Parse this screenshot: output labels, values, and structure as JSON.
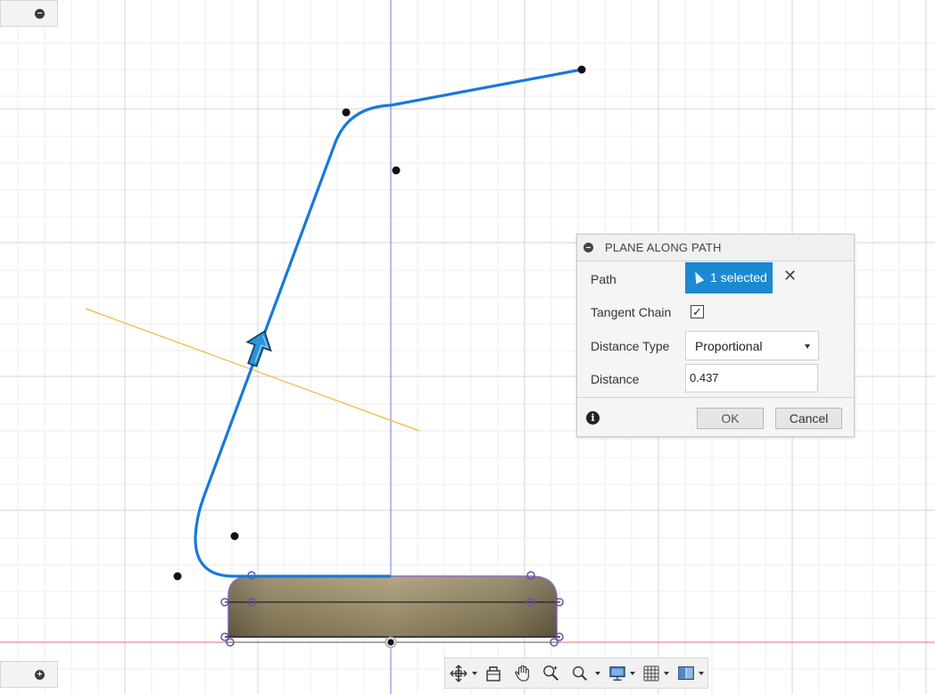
{
  "viewport": {
    "grid_color": "#d9d9d9",
    "path_color": "#1a7de0",
    "plane_color": "#f5b942",
    "body_color": "#8b7d5a",
    "axis_red": "#e05050",
    "axis_blue": "#5a6fd8"
  },
  "browser_toggle_top": {
    "icon": "minus-circle-icon"
  },
  "browser_toggle_bottom": {
    "icon": "plus-circle-icon"
  },
  "dialog": {
    "title": "PLANE ALONG PATH",
    "path_label": "Path",
    "path_value": "1 selected",
    "clear_icon": "✕",
    "tangent_chain_label": "Tangent Chain",
    "tangent_chain_checked": "✓",
    "distance_type_label": "Distance Type",
    "distance_type_value": "Proportional",
    "distance_label": "Distance",
    "distance_value": "0.437",
    "info_glyph": "i",
    "ok_label": "OK",
    "cancel_label": "Cancel"
  },
  "nav_toolbar": {
    "items": [
      "orbit-icon",
      "look-at-icon",
      "pan-icon",
      "zoom-icon",
      "fit-icon",
      "display-settings-icon",
      "grid-icon",
      "viewports-icon"
    ]
  }
}
